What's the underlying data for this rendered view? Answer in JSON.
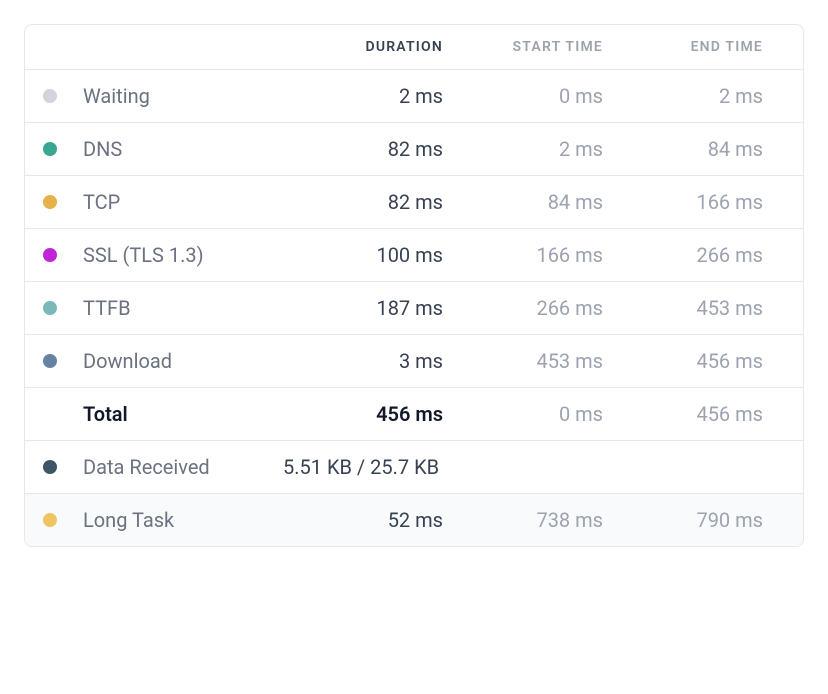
{
  "headers": {
    "duration": "DURATION",
    "start_time": "START TIME",
    "end_time": "END TIME"
  },
  "rows": [
    {
      "id": "waiting",
      "label": "Waiting",
      "dot_color": "#d1d5db",
      "duration": "2 ms",
      "start": "0 ms",
      "end": "2 ms"
    },
    {
      "id": "dns",
      "label": "DNS",
      "dot_color": "#3aa790",
      "duration": "82 ms",
      "start": "2 ms",
      "end": "84 ms"
    },
    {
      "id": "tcp",
      "label": "TCP",
      "dot_color": "#e4b14a",
      "duration": "82 ms",
      "start": "84 ms",
      "end": "166 ms"
    },
    {
      "id": "ssl",
      "label": "SSL (TLS 1.3)",
      "dot_color": "#c026d3",
      "duration": "100 ms",
      "start": "166 ms",
      "end": "266 ms"
    },
    {
      "id": "ttfb",
      "label": "TTFB",
      "dot_color": "#7bb8b8",
      "duration": "187 ms",
      "start": "266 ms",
      "end": "453 ms"
    },
    {
      "id": "download",
      "label": "Download",
      "dot_color": "#6683a3",
      "duration": "3 ms",
      "start": "453 ms",
      "end": "456 ms"
    }
  ],
  "total": {
    "label": "Total",
    "duration": "456 ms",
    "start": "0 ms",
    "end": "456 ms"
  },
  "data_received": {
    "label": "Data Received",
    "dot_color": "#3d5566",
    "value": "5.51 KB / 25.7 KB"
  },
  "long_task": {
    "label": "Long Task",
    "dot_color": "#f0c464",
    "duration": "52 ms",
    "start": "738 ms",
    "end": "790 ms"
  }
}
